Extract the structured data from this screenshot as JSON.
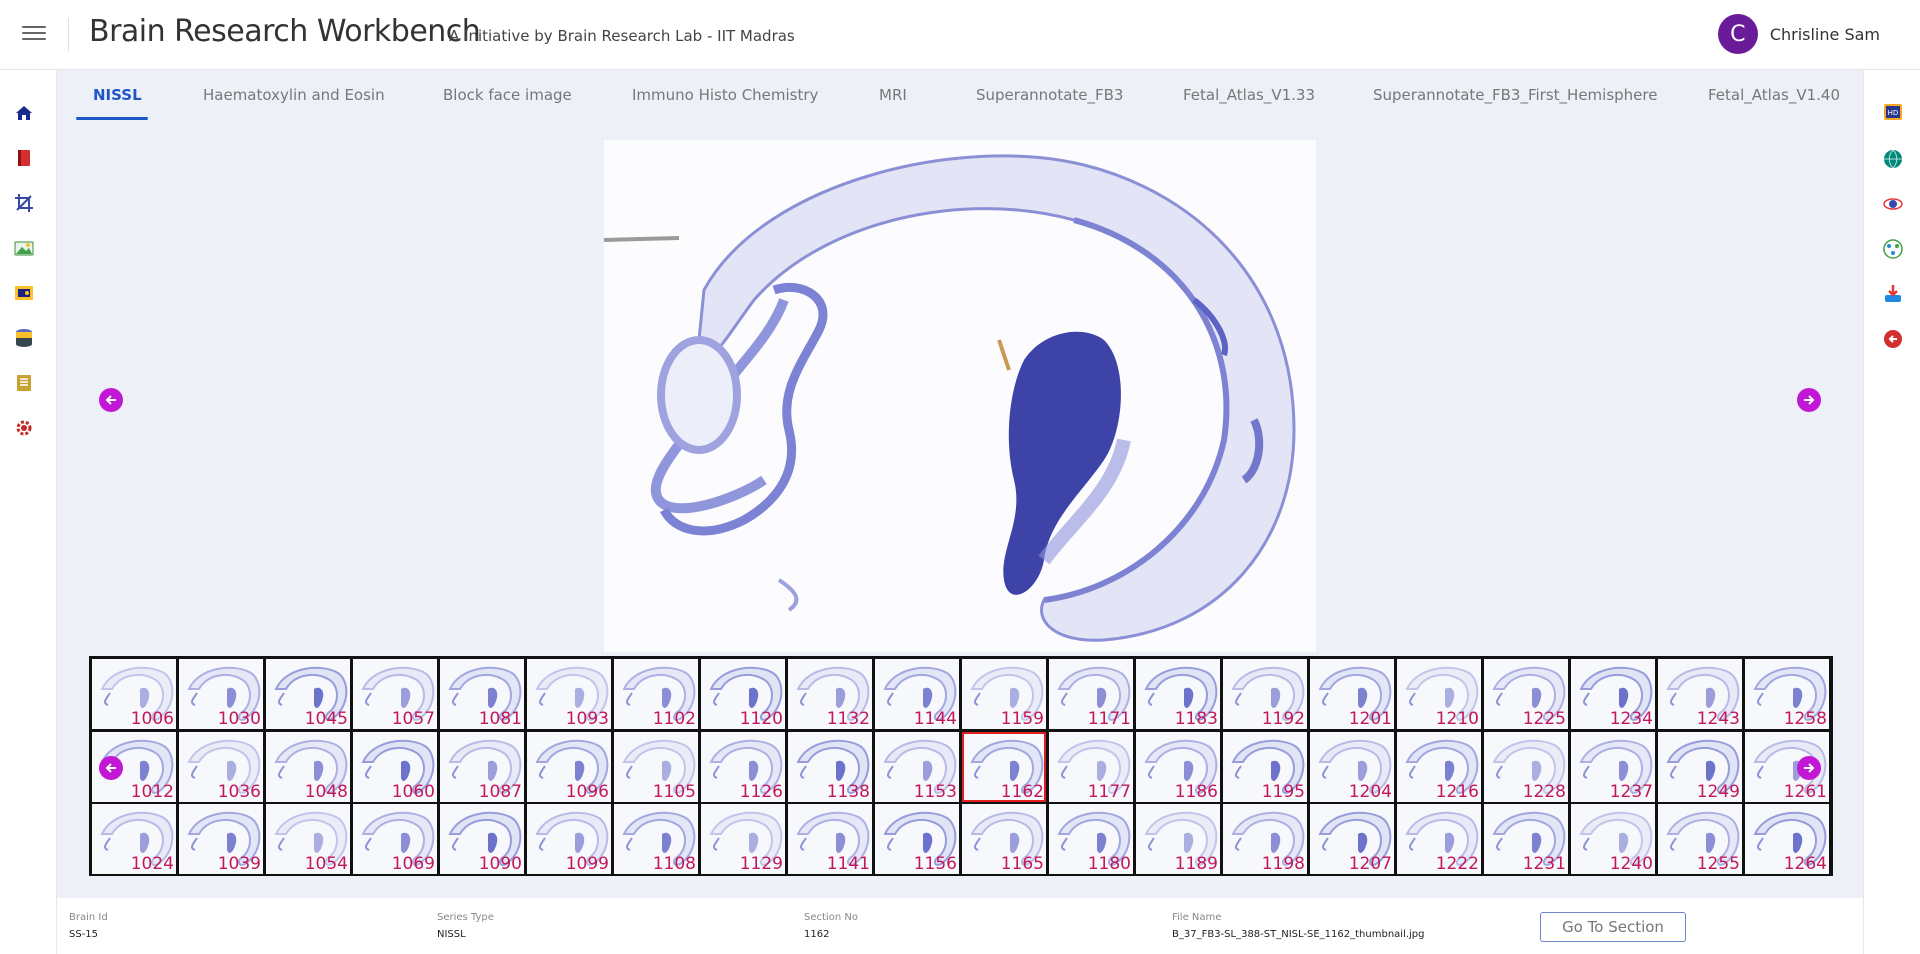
{
  "header": {
    "title": "Brain Research Workbench",
    "subtitle": "A Initiative by Brain Research Lab - IIT Madras",
    "user": {
      "initial": "C",
      "name": "Chrisline Sam"
    }
  },
  "left_rail": [
    {
      "name": "home-icon"
    },
    {
      "name": "book-icon"
    },
    {
      "name": "crop-icon"
    },
    {
      "name": "image-gallery-icon"
    },
    {
      "name": "slides-icon"
    },
    {
      "name": "database-icon"
    },
    {
      "name": "notebook-icon"
    },
    {
      "name": "settings-gear-icon"
    }
  ],
  "right_rail": [
    {
      "name": "hd-icon"
    },
    {
      "name": "globe-icon"
    },
    {
      "name": "orbit-icon"
    },
    {
      "name": "network-icon"
    },
    {
      "name": "download-icon"
    },
    {
      "name": "back-arrow-icon"
    }
  ],
  "tabs": [
    {
      "label": "NISSL",
      "active": true
    },
    {
      "label": "Haematoxylin and Eosin"
    },
    {
      "label": "Block face image"
    },
    {
      "label": "Immuno Histo Chemistry"
    },
    {
      "label": "MRI"
    },
    {
      "label": "Superannotate_FB3"
    },
    {
      "label": "Fetal_Atlas_V1.33"
    },
    {
      "label": "Superannotate_FB3_First_Hemisphere"
    },
    {
      "label": "Fetal_Atlas_V1.40"
    }
  ],
  "thumbnails": {
    "rows": [
      [
        "1006",
        "1030",
        "1045",
        "1057",
        "1081",
        "1093",
        "1102",
        "1120",
        "1132",
        "1144",
        "1159",
        "1171",
        "1183",
        "1192",
        "1201",
        "1210",
        "1225",
        "1234",
        "1243",
        "1258"
      ],
      [
        "1012",
        "1036",
        "1048",
        "1060",
        "1087",
        "1096",
        "1105",
        "1126",
        "1138",
        "1153",
        "1162",
        "1177",
        "1186",
        "1195",
        "1204",
        "1216",
        "1228",
        "1237",
        "1249",
        "1261"
      ],
      [
        "1024",
        "1039",
        "1054",
        "1069",
        "1090",
        "1099",
        "1108",
        "1129",
        "1141",
        "1156",
        "1165",
        "1180",
        "1189",
        "1198",
        "1207",
        "1222",
        "1231",
        "1240",
        "1255",
        "1264"
      ]
    ],
    "selected": "1162"
  },
  "footer": {
    "brain_id_label": "Brain Id",
    "brain_id": "SS-15",
    "series_type_label": "Series Type",
    "series_type": "NISSL",
    "section_no_label": "Section No",
    "section_no": "1162",
    "file_name_label": "File Name",
    "file_name": "B_37_FB3-SL_388-ST_NISL-SE_1162_thumbnail.jpg",
    "goto_label": "Go To Section"
  },
  "colors": {
    "accent": "#1e56c8",
    "arrow": "#c218d6",
    "thumb_number": "#c2185b",
    "avatar": "#6a1b9a"
  }
}
